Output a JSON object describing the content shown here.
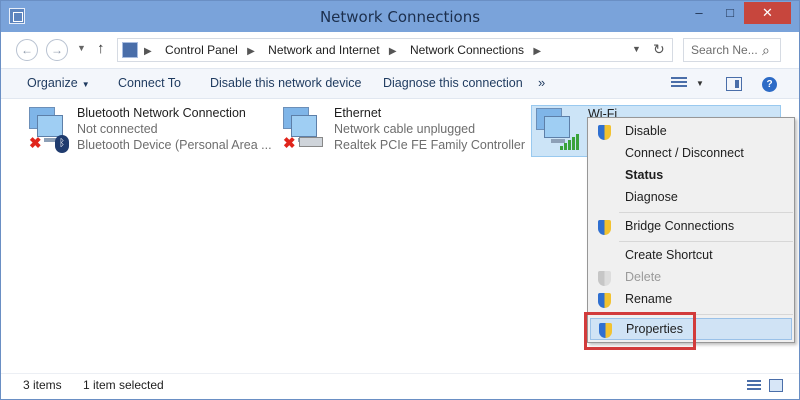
{
  "window": {
    "title": "Network Connections",
    "controls": {
      "minimize": "–",
      "maximize": "□",
      "close": "✕"
    }
  },
  "nav": {
    "back_glyph": "←",
    "forward_glyph": "→",
    "up_glyph": "↑",
    "breadcrumb": [
      "Control Panel",
      "Network and Internet",
      "Network Connections"
    ],
    "search_placeholder": "Search Ne...",
    "refresh_glyph": "↻"
  },
  "toolbar": {
    "organize": "Organize",
    "connect_to": "Connect To",
    "disable_device": "Disable this network device",
    "diagnose": "Diagnose this connection",
    "more": "»",
    "help": "?"
  },
  "connections": [
    {
      "name": "Bluetooth Network Connection",
      "status": "Not connected",
      "device": "Bluetooth Device (Personal Area ...",
      "icon": "bluetooth-icon"
    },
    {
      "name": "Ethernet",
      "status": "Network cable unplugged",
      "device": "Realtek PCIe FE Family Controller",
      "icon": "ethernet-cable-icon"
    },
    {
      "name": "Wi-Fi",
      "status": "",
      "device": "",
      "icon": "wifi-signal-icon",
      "selected": true
    }
  ],
  "context_menu": {
    "items": [
      {
        "label": "Disable",
        "shield": true
      },
      {
        "label": "Connect / Disconnect",
        "shield": false
      },
      {
        "label": "Status",
        "shield": false,
        "bold": true
      },
      {
        "label": "Diagnose",
        "shield": false
      },
      {
        "label": "Bridge Connections",
        "shield": true
      },
      {
        "label": "Create Shortcut",
        "shield": false
      },
      {
        "label": "Delete",
        "shield": true,
        "disabled": true
      },
      {
        "label": "Rename",
        "shield": true
      },
      {
        "label": "Properties",
        "shield": true,
        "hover": true
      }
    ]
  },
  "status": {
    "item_count": "3 items",
    "selection": "1 item selected"
  },
  "colors": {
    "titlebar": "#7aa3da",
    "close_button": "#c7463d",
    "selection": "#cce4f7",
    "highlight_box": "#d23b3b",
    "link_text": "#1e3a5f"
  }
}
